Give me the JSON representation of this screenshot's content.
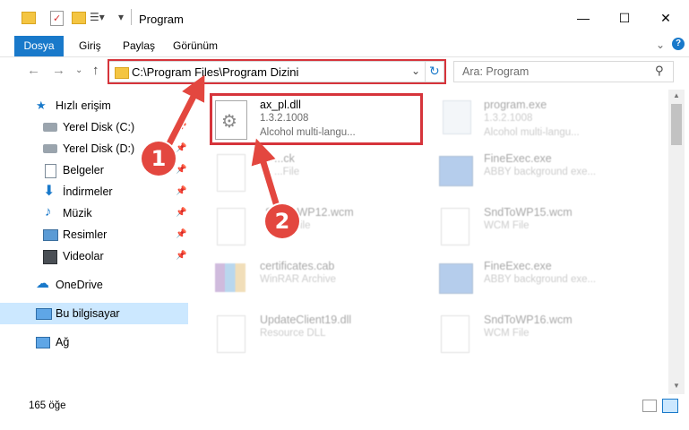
{
  "window": {
    "title": "Program"
  },
  "ribbon": {
    "tabs": [
      "Dosya",
      "Giriş",
      "Paylaş",
      "Görünüm"
    ]
  },
  "address": {
    "path": "C:\\Program Files\\Program Dizini"
  },
  "search": {
    "placeholder": "Ara: Program"
  },
  "nav": {
    "items": [
      {
        "label": "Hızlı erişim"
      },
      {
        "label": "Yerel Disk (C:)"
      },
      {
        "label": "Yerel Disk (D:)"
      },
      {
        "label": "Belgeler"
      },
      {
        "label": "İndirmeler"
      },
      {
        "label": "Müzik"
      },
      {
        "label": "Resimler"
      },
      {
        "label": "Videolar"
      },
      {
        "label": "OneDrive"
      },
      {
        "label": "Bu bilgisayar"
      },
      {
        "label": "Ağ"
      }
    ]
  },
  "files": [
    {
      "name": "ax_pl.dll",
      "line1": "1.3.2.1008",
      "line2": "Alcohol multi-langu..."
    },
    {
      "name": "program.exe",
      "line1": "1.3.2.1008",
      "line2": "Alcohol multi-langu..."
    },
    {
      "name": "...ck",
      "line1": "...File",
      "line2": ""
    },
    {
      "name": "FineExec.exe",
      "line1": "ABBY background exe...",
      "line2": ""
    },
    {
      "name": "SndToWP12.wcm",
      "line1": "WCM File",
      "line2": ""
    },
    {
      "name": "SndToWP15.wcm",
      "line1": "WCM File",
      "line2": ""
    },
    {
      "name": "certificates.cab",
      "line1": "WinRAR Archive",
      "line2": ""
    },
    {
      "name": "FineExec.exe",
      "line1": "ABBY background exe...",
      "line2": ""
    },
    {
      "name": "UpdateClient19.dll",
      "line1": "Resource DLL",
      "line2": ""
    },
    {
      "name": "SndToWP16.wcm",
      "line1": "WCM File",
      "line2": ""
    }
  ],
  "status": {
    "count": "165 öğe"
  },
  "annotations": {
    "step1": "1",
    "step2": "2"
  }
}
